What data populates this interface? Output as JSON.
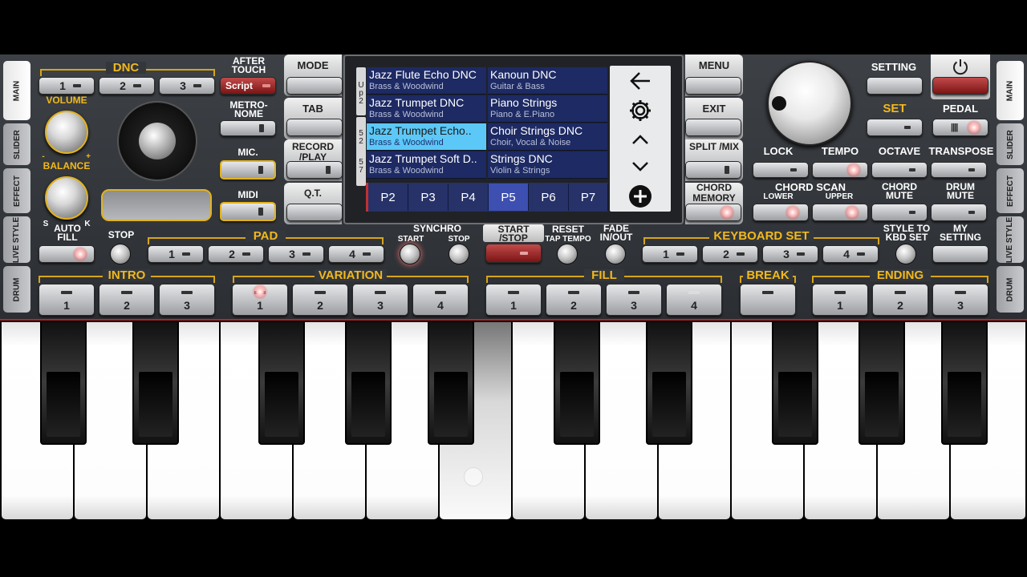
{
  "tabs_left": [
    "MAIN",
    "SLIDER",
    "EFFECT",
    "LIVE STYLE",
    "DRUM"
  ],
  "tabs_right": [
    "MAIN",
    "SLIDER",
    "EFFECT",
    "LIVE STYLE",
    "DRUM"
  ],
  "dnc": {
    "label": "DNC",
    "buttons": [
      "1",
      "2",
      "3"
    ]
  },
  "after_touch": {
    "label": "AFTER TOUCH",
    "script": "Script"
  },
  "metronome": "METRO- NOME",
  "mic": "MIC.",
  "midi": "MIDI",
  "volume": "VOLUME",
  "balance": "BALANCE",
  "s_mark": "S",
  "k_mark": "K",
  "minus_mark": "-",
  "plus_mark": "+",
  "left_menu": [
    "MODE",
    "TAB",
    "RECORD /PLAY",
    "Q.T."
  ],
  "right_menu": [
    "MENU",
    "EXIT",
    "SPLIT /MIX",
    "CHORD MEMORY"
  ],
  "up_side": {
    "text": "Up 2",
    "lines": [
      "U",
      "p",
      "2"
    ]
  },
  "num_side": {
    "text": "52 57",
    "lines": [
      "5",
      "2",
      "5",
      "7"
    ]
  },
  "styles": [
    {
      "name": "Jazz Flute Echo DNC",
      "category": "Brass & Woodwind"
    },
    {
      "name": "Kanoun DNC",
      "category": "Guitar & Bass"
    },
    {
      "name": "Jazz Trumpet DNC",
      "category": "Brass & Woodwind"
    },
    {
      "name": "Piano Strings",
      "category": "Piano & E.Piano"
    },
    {
      "name": "Jazz Trumpet Echo..",
      "category": "Brass & Woodwind"
    },
    {
      "name": "Choir Strings DNC",
      "category": "Choir, Vocal & Noise"
    },
    {
      "name": "Jazz Trumpet Soft D..",
      "category": "Brass & Woodwind"
    },
    {
      "name": "Strings DNC",
      "category": "Violin & Strings"
    }
  ],
  "pages": [
    "P2",
    "P3",
    "P4",
    "P5",
    "P6",
    "P7"
  ],
  "active_page": "P5",
  "top_right": {
    "setting": "SETTING",
    "set": "SET",
    "pedal": "PEDAL",
    "lock": "LOCK",
    "tempo": "TEMPO",
    "octave": "OCTAVE",
    "transpose": "TRANSPOSE",
    "chord_scan": "CHORD SCAN",
    "lower": "LOWER",
    "upper": "UPPER",
    "chord_mute": "CHORD MUTE",
    "drum_mute": "DRUM MUTE"
  },
  "row3": {
    "auto_fill": "AUTO FILL",
    "stop": "STOP",
    "pad": "PAD",
    "pad_buttons": [
      "1",
      "2",
      "3",
      "4"
    ],
    "synchro": "SYNCHRO",
    "synchro_start": "START",
    "synchro_stop": "STOP",
    "start_stop": "START /STOP",
    "reset": "RESET",
    "tap_tempo": "TAP TEMPO",
    "fade": "FADE IN/OUT",
    "keyboard_set": "KEYBOARD SET",
    "kbd_buttons": [
      "1",
      "2",
      "3",
      "4"
    ],
    "style_to_kbd": "STYLE TO KBD SET",
    "my_setting": "MY SETTING"
  },
  "row4": {
    "intro": {
      "label": "INTRO",
      "buttons": [
        "1",
        "2",
        "3"
      ]
    },
    "variation": {
      "label": "VARIATION",
      "buttons": [
        "1",
        "2",
        "3",
        "4"
      ]
    },
    "fill": {
      "label": "FILL",
      "buttons": [
        "1",
        "2",
        "3",
        "4"
      ]
    },
    "break": {
      "label": "BREAK"
    },
    "ending": {
      "label": "ENDING",
      "buttons": [
        "1",
        "2",
        "3"
      ]
    }
  },
  "colors": {
    "accent_gold": "#f2b91c",
    "selected_cell": "#5cc8f7",
    "cell_bg": "#1d2a63",
    "red_button": "#9b2323"
  },
  "icons": [
    "arrow-left-icon",
    "gear-icon",
    "chevron-up-icon",
    "chevron-down-icon",
    "plus-circle-icon",
    "power-icon"
  ]
}
